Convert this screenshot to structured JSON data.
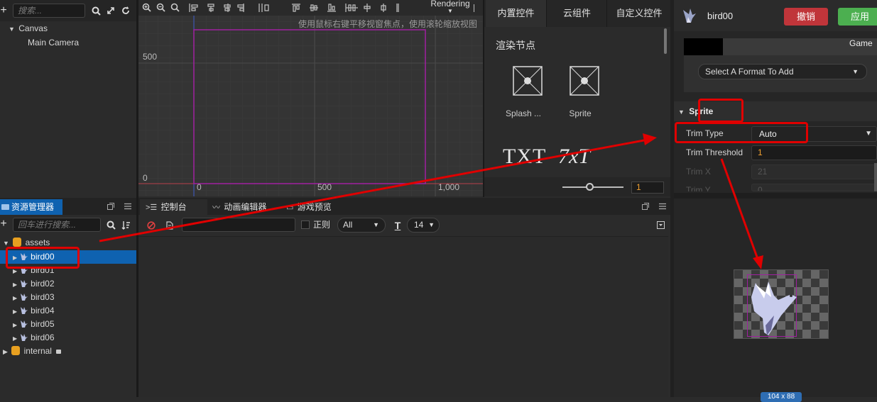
{
  "hierarchy": {
    "search_placeholder": "搜索...",
    "nodes": [
      {
        "label": "Canvas"
      },
      {
        "label": "Main Camera"
      }
    ]
  },
  "scene": {
    "rendering_label": "Rendering",
    "hint": "使用鼠标右键平移视窗焦点，使用滚轮缩放视图",
    "y_ticks": [
      "500",
      "0"
    ],
    "x_ticks": [
      "0",
      "500",
      "1,000"
    ]
  },
  "widgets": {
    "tabs": [
      "内置控件",
      "云组件",
      "自定义控件"
    ],
    "section_title": "渲染节点",
    "items": [
      {
        "label": "Splash ..."
      },
      {
        "label": "Sprite"
      }
    ],
    "txt_items": [
      "TXT",
      "7xT"
    ],
    "zoom_value": "1"
  },
  "assets": {
    "title": "资源管理器",
    "search_placeholder": "回车进行搜索...",
    "root": "assets",
    "items": [
      "bird00",
      "bird01",
      "bird02",
      "bird03",
      "bird04",
      "bird05",
      "bird06"
    ],
    "internal": "internal"
  },
  "console": {
    "tabs": [
      "控制台",
      "动画编辑器",
      "游戏预览"
    ],
    "regex_label": "正则",
    "level_filter": "All",
    "font_size": "14"
  },
  "inspector": {
    "asset_name": "bird00",
    "revert_label": "撤销",
    "apply_label": "应用",
    "platform_label": "Game",
    "format_select": "Select A Format To Add",
    "section": "Sprite",
    "props": [
      {
        "label": "Trim Type",
        "value": "Auto"
      },
      {
        "label": "Trim Threshold",
        "value": "1"
      },
      {
        "label": "Trim X",
        "value": "21"
      },
      {
        "label": "Trim Y",
        "value": "0"
      }
    ],
    "size_badge": "104 x 88"
  },
  "colors": {
    "accent_blue": "#0f62b0",
    "revert_red": "#c0353a",
    "apply_green": "#4caf50",
    "annotation_red": "#e00000",
    "canvas_frame": "#a020a0"
  }
}
